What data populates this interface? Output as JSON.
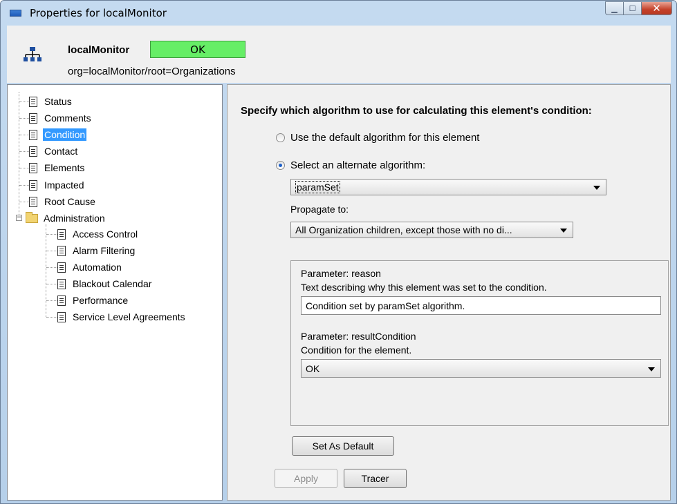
{
  "window": {
    "title": "Properties for localMonitor"
  },
  "header": {
    "element_name": "localMonitor",
    "status": "OK",
    "status_color": "#66ee66",
    "path": "org=localMonitor/root=Organizations"
  },
  "tree": {
    "items": [
      {
        "label": "Status",
        "icon": "document-icon"
      },
      {
        "label": "Comments",
        "icon": "document-icon"
      },
      {
        "label": "Condition",
        "icon": "document-icon",
        "selected": true
      },
      {
        "label": "Contact",
        "icon": "document-icon"
      },
      {
        "label": "Elements",
        "icon": "document-icon"
      },
      {
        "label": "Impacted",
        "icon": "document-icon"
      },
      {
        "label": "Root Cause",
        "icon": "document-icon"
      },
      {
        "label": "Administration",
        "icon": "folder-icon",
        "expanded": true,
        "children": [
          {
            "label": "Access Control"
          },
          {
            "label": "Alarm Filtering"
          },
          {
            "label": "Automation"
          },
          {
            "label": "Blackout Calendar"
          },
          {
            "label": "Performance"
          },
          {
            "label": "Service Level Agreements"
          }
        ]
      }
    ]
  },
  "condition": {
    "heading": "Specify which algorithm to use for calculating this element's condition:",
    "radio_default": "Use the default algorithm for this element",
    "radio_alternate": "Select an alternate algorithm:",
    "algorithm_value": "paramSet",
    "propagate_label": "Propagate to:",
    "propagate_value": "All Organization children, except those with no di...",
    "param1_title": "Parameter: reason",
    "param1_desc": "Text describing why this element was set to the condition.",
    "param1_value": "Condition set by paramSet algorithm.",
    "param2_title": "Parameter: resultCondition",
    "param2_desc": "Condition for the element.",
    "param2_value": "OK",
    "set_default_button": "Set As Default",
    "apply_button": "Apply",
    "tracer_button": "Tracer"
  }
}
